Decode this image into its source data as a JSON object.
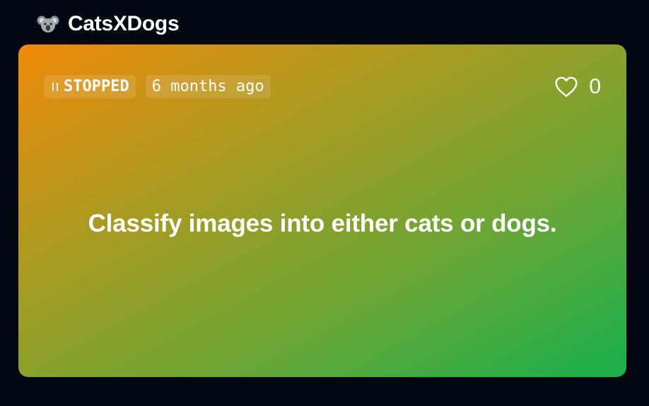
{
  "header": {
    "logo_icon": "koala-icon",
    "title": "CatsXDogs"
  },
  "card": {
    "status": {
      "icon": "pause-icon",
      "label": "STOPPED"
    },
    "updated": "6 months ago",
    "likes": {
      "icon": "heart-icon",
      "count": "0"
    },
    "description": "Classify images into either cats or dogs.",
    "gradient": {
      "from": "#ef8a0a",
      "to": "#17b04e"
    }
  }
}
